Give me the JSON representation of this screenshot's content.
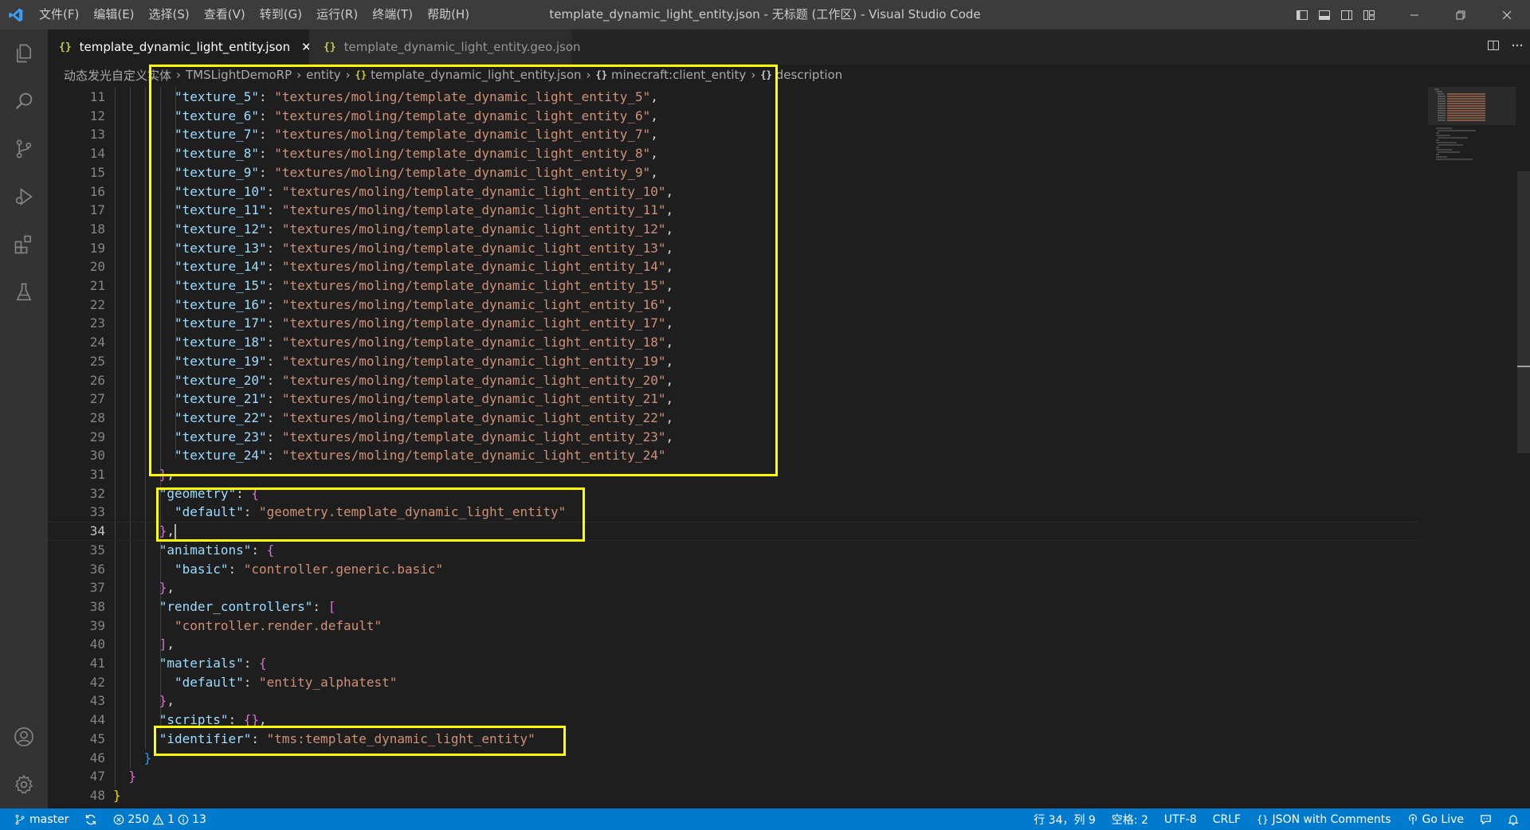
{
  "titlebar": {
    "window_title": "template_dynamic_light_entity.json - 无标题 (工作区) - Visual Studio Code",
    "menu": [
      "文件(F)",
      "编辑(E)",
      "选择(S)",
      "查看(V)",
      "转到(G)",
      "运行(R)",
      "终端(T)",
      "帮助(H)"
    ]
  },
  "tabs": [
    {
      "icon": "{}",
      "label": "template_dynamic_light_entity.json",
      "active": true,
      "close": "✕"
    },
    {
      "icon": "{}",
      "label": "template_dynamic_light_entity.geo.json",
      "active": false
    }
  ],
  "breadcrumb": [
    {
      "label": "动态发光自定义实体"
    },
    {
      "label": "TMSLightDemoRP"
    },
    {
      "label": "entity"
    },
    {
      "icon": "{}",
      "label": "template_dynamic_light_entity.json"
    },
    {
      "icon": "{}",
      "label": "minecraft:client_entity"
    },
    {
      "icon": "{}",
      "label": "description"
    }
  ],
  "editor": {
    "current_line": 34,
    "lines": [
      {
        "n": "11",
        "key": "\"texture_5\"",
        "val": "\"textures/moling/template_dynamic_light_entity_5\"",
        "tail": ","
      },
      {
        "n": "12",
        "key": "\"texture_6\"",
        "val": "\"textures/moling/template_dynamic_light_entity_6\"",
        "tail": ","
      },
      {
        "n": "13",
        "key": "\"texture_7\"",
        "val": "\"textures/moling/template_dynamic_light_entity_7\"",
        "tail": ","
      },
      {
        "n": "14",
        "key": "\"texture_8\"",
        "val": "\"textures/moling/template_dynamic_light_entity_8\"",
        "tail": ","
      },
      {
        "n": "15",
        "key": "\"texture_9\"",
        "val": "\"textures/moling/template_dynamic_light_entity_9\"",
        "tail": ","
      },
      {
        "n": "16",
        "key": "\"texture_10\"",
        "val": "\"textures/moling/template_dynamic_light_entity_10\"",
        "tail": ","
      },
      {
        "n": "17",
        "key": "\"texture_11\"",
        "val": "\"textures/moling/template_dynamic_light_entity_11\"",
        "tail": ","
      },
      {
        "n": "18",
        "key": "\"texture_12\"",
        "val": "\"textures/moling/template_dynamic_light_entity_12\"",
        "tail": ","
      },
      {
        "n": "19",
        "key": "\"texture_13\"",
        "val": "\"textures/moling/template_dynamic_light_entity_13\"",
        "tail": ","
      },
      {
        "n": "20",
        "key": "\"texture_14\"",
        "val": "\"textures/moling/template_dynamic_light_entity_14\"",
        "tail": ","
      },
      {
        "n": "21",
        "key": "\"texture_15\"",
        "val": "\"textures/moling/template_dynamic_light_entity_15\"",
        "tail": ","
      },
      {
        "n": "22",
        "key": "\"texture_16\"",
        "val": "\"textures/moling/template_dynamic_light_entity_16\"",
        "tail": ","
      },
      {
        "n": "23",
        "key": "\"texture_17\"",
        "val": "\"textures/moling/template_dynamic_light_entity_17\"",
        "tail": ","
      },
      {
        "n": "24",
        "key": "\"texture_18\"",
        "val": "\"textures/moling/template_dynamic_light_entity_18\"",
        "tail": ","
      },
      {
        "n": "25",
        "key": "\"texture_19\"",
        "val": "\"textures/moling/template_dynamic_light_entity_19\"",
        "tail": ","
      },
      {
        "n": "26",
        "key": "\"texture_20\"",
        "val": "\"textures/moling/template_dynamic_light_entity_20\"",
        "tail": ","
      },
      {
        "n": "27",
        "key": "\"texture_21\"",
        "val": "\"textures/moling/template_dynamic_light_entity_21\"",
        "tail": ","
      },
      {
        "n": "28",
        "key": "\"texture_22\"",
        "val": "\"textures/moling/template_dynamic_light_entity_22\"",
        "tail": ","
      },
      {
        "n": "29",
        "key": "\"texture_23\"",
        "val": "\"textures/moling/template_dynamic_light_entity_23\"",
        "tail": ","
      },
      {
        "n": "30",
        "key": "\"texture_24\"",
        "val": "\"textures/moling/template_dynamic_light_entity_24\"",
        "tail": ""
      },
      {
        "n": "31",
        "close": "}",
        "tail": ","
      },
      {
        "n": "32",
        "key": "\"geometry\"",
        "open": "{"
      },
      {
        "n": "33",
        "key": "\"default\"",
        "val": "\"geometry.template_dynamic_light_entity\"",
        "tail": ""
      },
      {
        "n": "34",
        "close": "}",
        "tail": ","
      },
      {
        "n": "35",
        "key": "\"animations\"",
        "open": "{"
      },
      {
        "n": "36",
        "key": "\"basic\"",
        "val": "\"controller.generic.basic\"",
        "tail": ""
      },
      {
        "n": "37",
        "close": "}",
        "tail": ","
      },
      {
        "n": "38",
        "key": "\"render_controllers\"",
        "open": "["
      },
      {
        "n": "39",
        "val": "\"controller.render.default\"",
        "tail": ""
      },
      {
        "n": "40",
        "close": "]",
        "tail": ","
      },
      {
        "n": "41",
        "key": "\"materials\"",
        "open": "{"
      },
      {
        "n": "42",
        "key": "\"default\"",
        "val": "\"entity_alphatest\"",
        "tail": ""
      },
      {
        "n": "43",
        "close": "}",
        "tail": ","
      },
      {
        "n": "44",
        "key": "\"scripts\"",
        "open": "{}",
        "tail": ","
      },
      {
        "n": "45",
        "key": "\"identifier\"",
        "val": "\"tms:template_dynamic_light_entity\"",
        "tail": ""
      },
      {
        "n": "46",
        "close": "}",
        "tail": ""
      },
      {
        "n": "47",
        "close": "}",
        "tail": ""
      },
      {
        "n": "48",
        "close": "}",
        "tail": ""
      }
    ]
  },
  "statusbar": {
    "branch": "master",
    "errors": "250",
    "warnings": "1",
    "infos": "13",
    "cursor_pos": "行 34，列 9",
    "indent": "空格: 2",
    "encoding": "UTF-8",
    "eol": "CRLF",
    "language": "JSON with Comments",
    "go_live": "Go Live"
  },
  "colors": {
    "status_bar": "#007acc",
    "highlight": "#ffff00",
    "string": "#ce9178",
    "key": "#9cdcfe"
  }
}
